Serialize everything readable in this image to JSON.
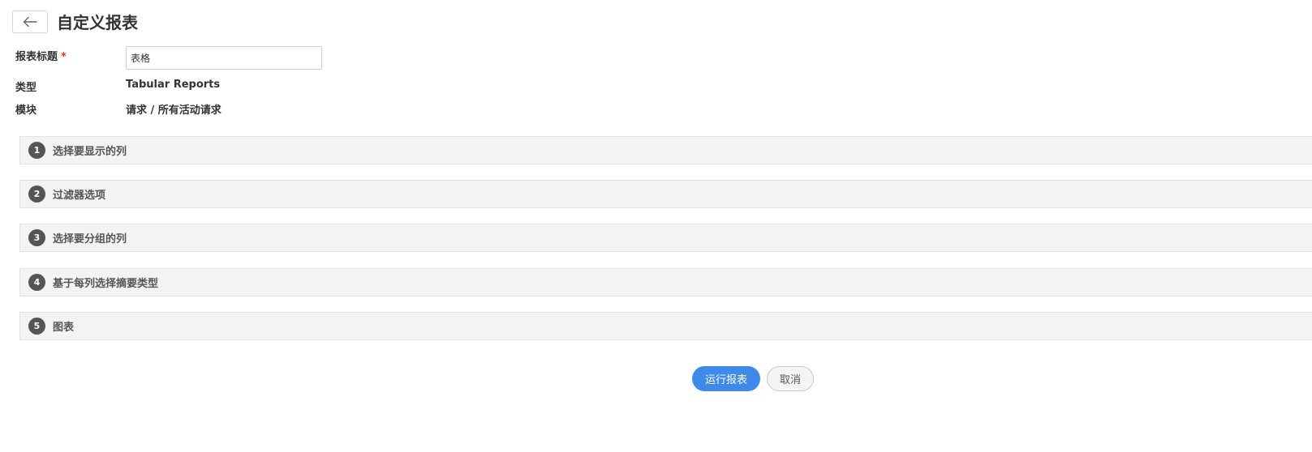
{
  "header": {
    "back_icon": "arrow-left-icon",
    "title": "自定义报表"
  },
  "form": {
    "report_title": {
      "label": "报表标题",
      "required_mark": "*",
      "value": "表格"
    },
    "type": {
      "label": "类型",
      "value": "Tabular Reports"
    },
    "module": {
      "label": "模块",
      "value": "请求 / 所有活动请求"
    }
  },
  "sections": [
    {
      "number": "1",
      "label": "选择要显示的列"
    },
    {
      "number": "2",
      "label": "过滤器选项"
    },
    {
      "number": "3",
      "label": "选择要分组的列"
    },
    {
      "number": "4",
      "label": "基于每列选择摘要类型"
    },
    {
      "number": "5",
      "label": "图表"
    }
  ],
  "actions": {
    "run_label": "运行报表",
    "cancel_label": "取消"
  },
  "colors": {
    "primary": "#3f89e8",
    "required": "#e0302a",
    "step_badge": "#555555",
    "section_bg": "#f3f3f3"
  }
}
